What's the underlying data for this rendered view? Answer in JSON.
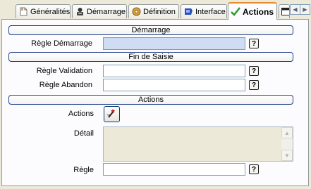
{
  "tabs": [
    {
      "label": "Généralités",
      "icon": "page-icon"
    },
    {
      "label": "Démarrage",
      "icon": "robot-icon"
    },
    {
      "label": "Définition",
      "icon": "gear-icon"
    },
    {
      "label": "Interface",
      "icon": "monitor-icon"
    },
    {
      "label": "Actions",
      "icon": "checkmark-icon",
      "active": true
    },
    {
      "label": "",
      "icon": "window-icon"
    }
  ],
  "sections": {
    "demarrage": "Démarrage",
    "fin_saisie": "Fin de Saisie",
    "actions": "Actions"
  },
  "fields": {
    "regle_demarrage": {
      "label": "Règle Démarrage",
      "value": ""
    },
    "regle_validation": {
      "label": "Règle Validation",
      "value": ""
    },
    "regle_abandon": {
      "label": "Règle Abandon",
      "value": ""
    },
    "actions": {
      "label": "Actions"
    },
    "detail": {
      "label": "Détail",
      "value": ""
    },
    "regle": {
      "label": "Règle",
      "value": ""
    }
  },
  "help_glyph": "?",
  "colors": {
    "highlight_field": "#cfdcf3",
    "active_tab_accent": "#e68b2c",
    "section_border": "#1e3e8a"
  }
}
